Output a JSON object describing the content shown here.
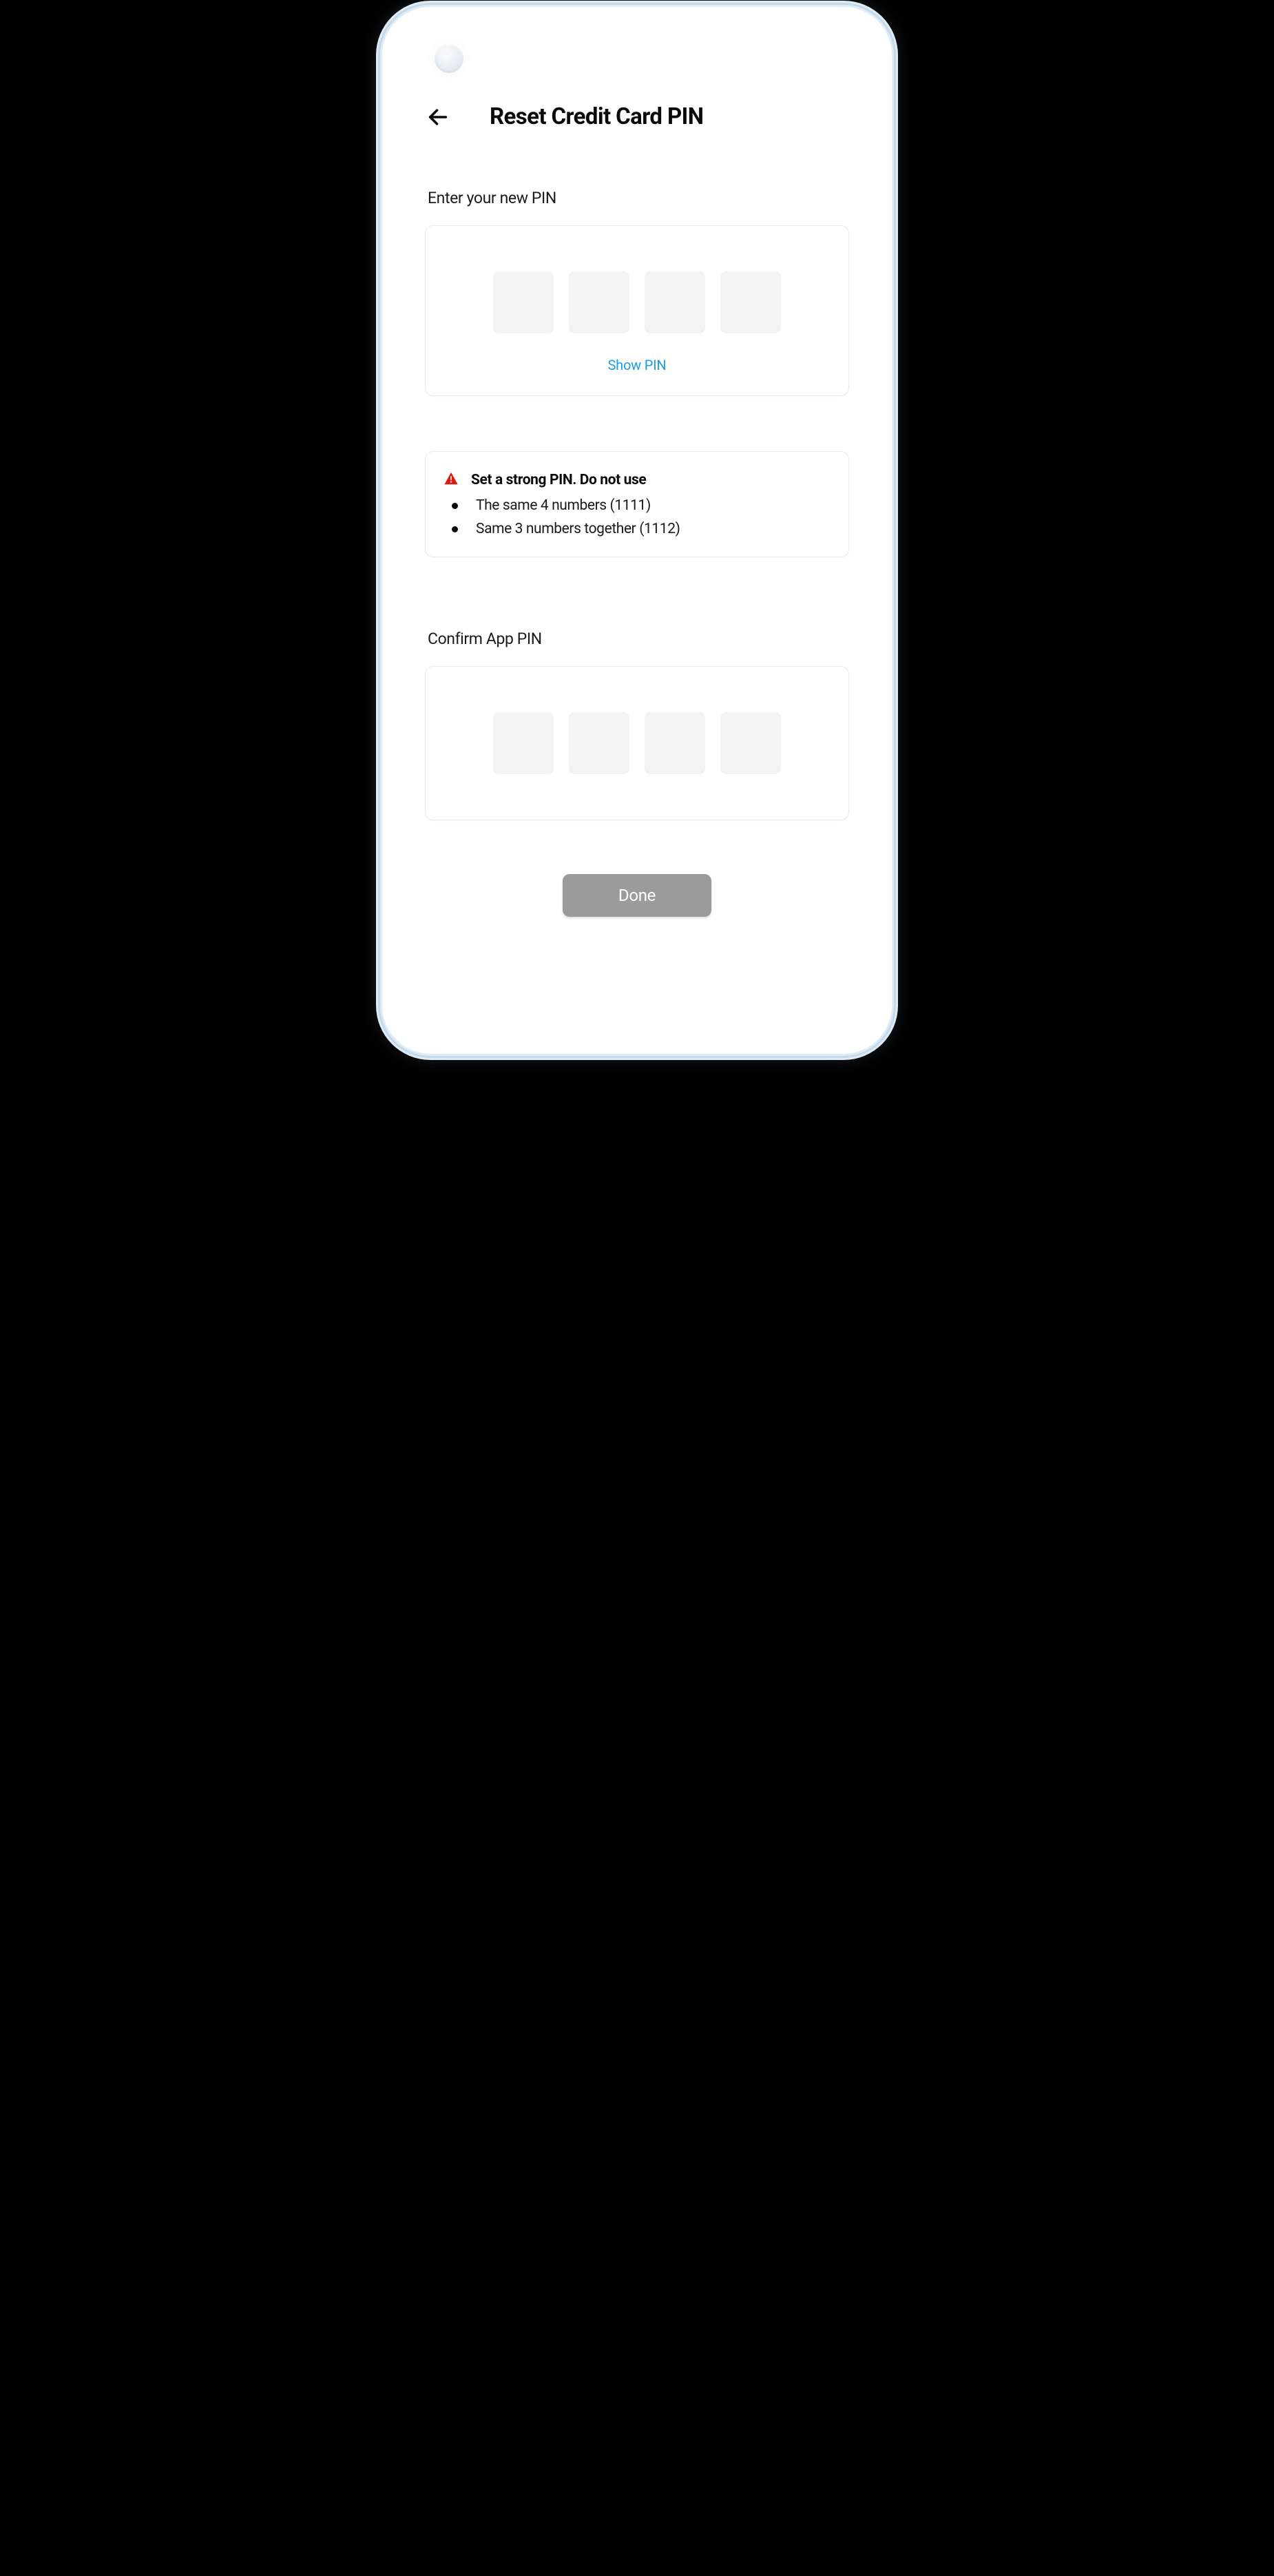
{
  "header": {
    "title": "Reset Credit Card PIN"
  },
  "sections": {
    "new_pin": {
      "label": "Enter your new PIN",
      "show_pin_label": "Show PIN",
      "digits": 4
    },
    "confirm_pin": {
      "label": "Confirm App PIN",
      "digits": 4
    }
  },
  "warning": {
    "title": "Set a strong PIN. Do not use",
    "rules": [
      "The same 4 numbers (1111)",
      "Same 3 numbers together (1112)"
    ]
  },
  "actions": {
    "done_label": "Done"
  },
  "colors": {
    "accent_link": "#1e9cf0",
    "warning_icon": "#e5160b",
    "done_button_bg": "#9b9b9b"
  }
}
